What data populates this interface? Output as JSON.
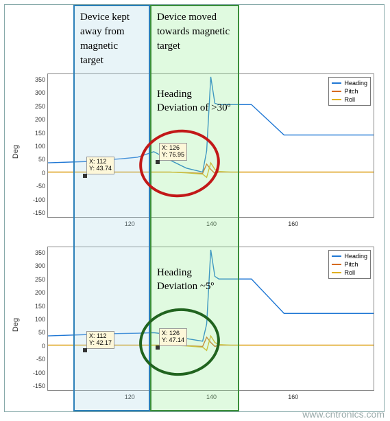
{
  "regions": {
    "blue_label": "Device kept away from magnetic target",
    "green_label": "Device moved towards magnetic target"
  },
  "annotations": {
    "top_text_l1": "Heading",
    "top_text_l2": "Deviation of >30º",
    "bot_text_l1": "Heading",
    "bot_text_l2": "Deviation ~5º"
  },
  "axis": {
    "ylabel": "Deg",
    "y_ticks": [
      "-150",
      "-100",
      "-50",
      "0",
      "50",
      "100",
      "150",
      "200",
      "250",
      "300",
      "350"
    ],
    "x_ticks": [
      "120",
      "140",
      "160"
    ]
  },
  "legend": {
    "heading": "Heading",
    "pitch": "Pitch",
    "roll": "Roll"
  },
  "datatips": {
    "top_1_l1": "X: 112",
    "top_1_l2": "Y: 43.74",
    "top_2_l1": "X: 126",
    "top_2_l2": "Y: 76.95",
    "bot_1_l1": "X: 112",
    "bot_1_l2": "Y: 42.17",
    "bot_2_l1": "X: 126",
    "bot_2_l2": "Y: 47.14"
  },
  "watermark": "www.cntronics.com",
  "chart_data": [
    {
      "type": "line",
      "title": "Heading deviation without compensation",
      "ylabel": "Deg",
      "ylim": [
        -170,
        370
      ],
      "xlim": [
        100,
        180
      ],
      "legend_position": "top-right",
      "annotation": "Heading Deviation of >30º",
      "datatips": [
        {
          "x": 112,
          "y": 43.74,
          "series": "Heading"
        },
        {
          "x": 126,
          "y": 76.95,
          "series": "Heading"
        }
      ],
      "x": [
        100,
        110,
        112,
        118,
        122,
        126,
        130,
        134,
        138,
        139,
        140,
        141,
        142,
        145,
        150,
        158,
        160,
        180
      ],
      "series": [
        {
          "name": "Heading",
          "color": "#1f77d4",
          "values": [
            35,
            40,
            43.74,
            50,
            56,
            76.95,
            45,
            15,
            0,
            80,
            360,
            260,
            255,
            255,
            255,
            140,
            140,
            140
          ]
        },
        {
          "name": "Pitch",
          "color": "#d66a1f",
          "values": [
            0,
            0,
            0,
            0,
            0,
            0,
            0,
            -2,
            -5,
            30,
            10,
            -5,
            0,
            0,
            0,
            0,
            0,
            0
          ]
        },
        {
          "name": "Roll",
          "color": "#e0b020",
          "values": [
            0,
            0,
            0,
            0,
            0,
            0,
            0,
            -3,
            -8,
            -20,
            35,
            10,
            2,
            0,
            0,
            0,
            0,
            0
          ]
        }
      ]
    },
    {
      "type": "line",
      "title": "Heading deviation with compensation",
      "ylabel": "Deg",
      "ylim": [
        -170,
        370
      ],
      "xlim": [
        100,
        180
      ],
      "legend_position": "top-right",
      "annotation": "Heading Deviation ~5º",
      "datatips": [
        {
          "x": 112,
          "y": 42.17,
          "series": "Heading"
        },
        {
          "x": 126,
          "y": 47.14,
          "series": "Heading"
        }
      ],
      "x": [
        100,
        110,
        112,
        118,
        122,
        126,
        130,
        134,
        138,
        139,
        140,
        141,
        142,
        145,
        150,
        158,
        160,
        180
      ],
      "series": [
        {
          "name": "Heading",
          "color": "#1f77d4",
          "values": [
            35,
            40,
            42.17,
            44,
            45,
            47.14,
            40,
            25,
            15,
            80,
            360,
            260,
            250,
            250,
            250,
            120,
            120,
            120
          ]
        },
        {
          "name": "Pitch",
          "color": "#d66a1f",
          "values": [
            0,
            0,
            0,
            0,
            0,
            0,
            0,
            -2,
            -5,
            30,
            10,
            -5,
            0,
            0,
            0,
            0,
            0,
            0
          ]
        },
        {
          "name": "Roll",
          "color": "#e0b020",
          "values": [
            0,
            0,
            0,
            0,
            0,
            0,
            0,
            -3,
            -8,
            -20,
            35,
            10,
            2,
            0,
            0,
            0,
            0,
            0
          ]
        }
      ]
    }
  ]
}
